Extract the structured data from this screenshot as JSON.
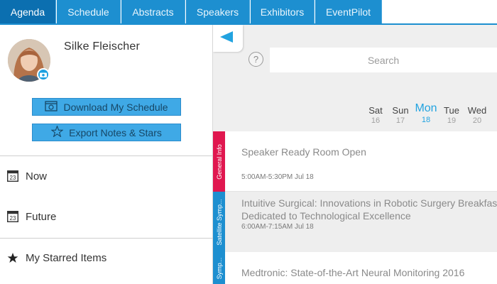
{
  "tabs": [
    {
      "label": "Agenda",
      "active": true
    },
    {
      "label": "Schedule",
      "active": false
    },
    {
      "label": "Abstracts",
      "active": false
    },
    {
      "label": "Speakers",
      "active": false
    },
    {
      "label": "Exhibitors",
      "active": false
    },
    {
      "label": "EventPilot",
      "active": false
    }
  ],
  "profile": {
    "name": "Silke  Fleischer"
  },
  "actions": {
    "download_label": "Download My Schedule",
    "export_label": "Export Notes & Stars"
  },
  "menu": {
    "now_label": "Now",
    "future_label": "Future",
    "starred_label": "My Starred Items",
    "calendar_icon_text": "23"
  },
  "help": {
    "symbol": "?"
  },
  "search": {
    "placeholder": "Search"
  },
  "days": [
    {
      "name": "Sat",
      "date": "16",
      "selected": false
    },
    {
      "name": "Sun",
      "date": "17",
      "selected": false
    },
    {
      "name": "Mon",
      "date": "18",
      "selected": true
    },
    {
      "name": "Tue",
      "date": "19",
      "selected": false
    },
    {
      "name": "Wed",
      "date": "20",
      "selected": false
    }
  ],
  "sessions": [
    {
      "category": "General Info",
      "category_color": "#e0174f",
      "title_line1": "Speaker Ready Room Open",
      "title_line2": "",
      "time": "5:00AM-5:30PM Jul 18"
    },
    {
      "category": "Satellite Symp...",
      "category_color": "#1d8fd0",
      "title_line1": "Intuitive Surgical: Innovations in Robotic Surgery Breakfast",
      "title_line2": "Dedicated to Technological Excellence",
      "time": "6:00AM-7:15AM Jul 18"
    },
    {
      "category": "Symp...",
      "category_color": "#1d8fd0",
      "title_line1": "Medtronic: State-of-the-Art Neural Monitoring 2016",
      "title_line2": "",
      "time": ""
    }
  ],
  "colors": {
    "tab_bg": "#1d8fd0",
    "tab_active_bg": "#0b6fb0",
    "button_bg": "#3fa9e6",
    "accent": "#22a3e0",
    "general_info": "#e0174f",
    "satellite": "#1d8fd0"
  }
}
